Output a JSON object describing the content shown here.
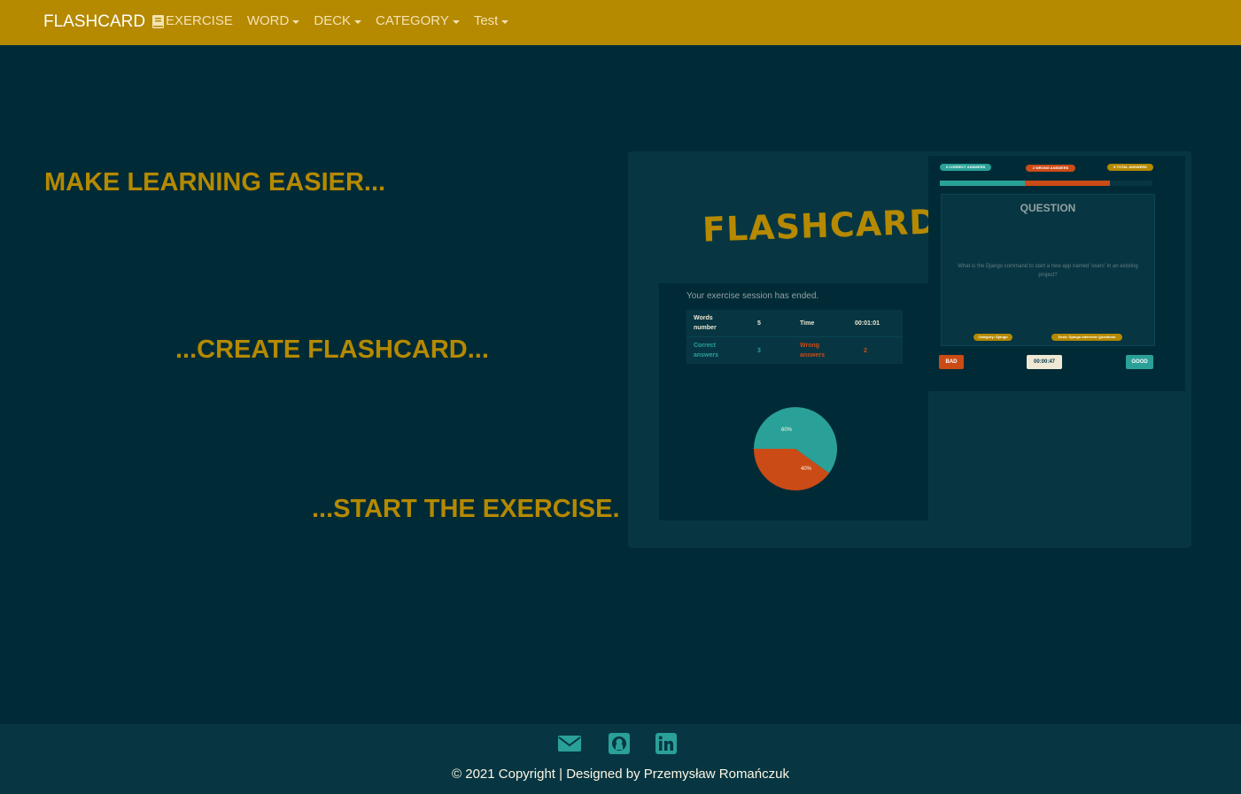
{
  "navbar": {
    "brand": "FLASHCARD",
    "items": [
      {
        "label": "EXERCISE",
        "icon": "book-icon",
        "dropdown": false
      },
      {
        "label": "WORD",
        "dropdown": true
      },
      {
        "label": "DECK",
        "dropdown": true
      },
      {
        "label": "CATEGORY",
        "dropdown": true
      },
      {
        "label": "Test",
        "dropdown": true
      }
    ],
    "background": "#b58900"
  },
  "hero": {
    "line1": "MAKE LEARNING EASIER...",
    "line2": "...CREATE FLASHCARD...",
    "line3": "...START THE EXERCISE."
  },
  "preview": {
    "logo": "FLASHCARD",
    "result_title": "Your exercise session has ended.",
    "table": {
      "words_number_label": "Words number",
      "words_number": "5",
      "time_label": "Time",
      "time": "00:01:01",
      "correct_label": "Correct answers",
      "correct": "3",
      "wrong_label": "Wrong answers",
      "wrong": "2"
    },
    "pie": {
      "correct_pct": 60,
      "wrong_pct": 40,
      "correct_label": "60%",
      "wrong_label": "40%"
    },
    "badges": {
      "correct": "3 CORRECT ANSWERS",
      "wrong": "2 WRONG ANSWERS",
      "total": "5 TOTAL ANSWERS"
    },
    "question_title": "QUESTION",
    "question_text": "What is the Django command to start a new app named 'users' in an existing project?",
    "category_pill": "Category: Django",
    "deck_pill": "Deck: Django Interview Questions",
    "buttons": {
      "bad": "BAD",
      "timer": "00:00:47",
      "good": "GOOD"
    }
  },
  "footer": {
    "icons": [
      "mail-icon",
      "github-icon",
      "linkedin-icon"
    ],
    "copyright": "© 2021 Copyright | Designed by Przemysław Romańczuk"
  },
  "colors": {
    "page_bg": "#002b36",
    "accent": "#b58900",
    "footer_bg": "#073642",
    "teal": "#2aa198",
    "orange": "#cb4b16"
  }
}
